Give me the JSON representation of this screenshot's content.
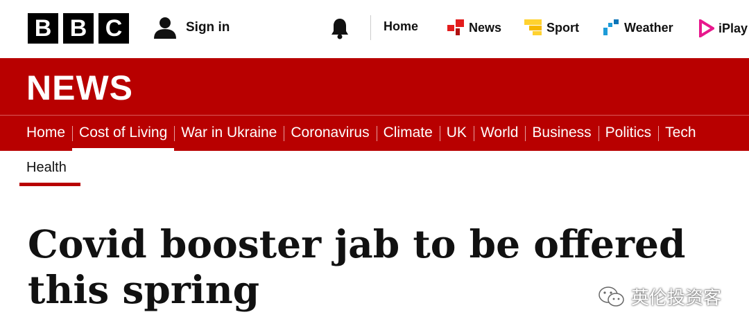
{
  "header": {
    "logo_letters": [
      "B",
      "B",
      "C"
    ],
    "sign_in": "Sign in",
    "nav": [
      {
        "label": "Home",
        "icon": "none",
        "color": ""
      },
      {
        "label": "News",
        "icon": "news-icon",
        "color": "#e31c1c"
      },
      {
        "label": "Sport",
        "icon": "sport-icon",
        "color": "#ffd230"
      },
      {
        "label": "Weather",
        "icon": "weather-icon",
        "color": "#1d9bd8"
      },
      {
        "label": "iPlay",
        "icon": "iplayer-icon",
        "color": "#e8188d"
      }
    ]
  },
  "news": {
    "title": "NEWS",
    "sections": [
      "Home",
      "Cost of Living",
      "War in Ukraine",
      "Coronavirus",
      "Climate",
      "UK",
      "World",
      "Business",
      "Politics",
      "Tech"
    ],
    "active_section": "Cost of Living",
    "subsection": "Health"
  },
  "article": {
    "headline": "Covid booster jab to be offered this spring"
  },
  "watermark": {
    "text": "英伦投资客"
  },
  "colors": {
    "brand_red": "#b80000"
  }
}
